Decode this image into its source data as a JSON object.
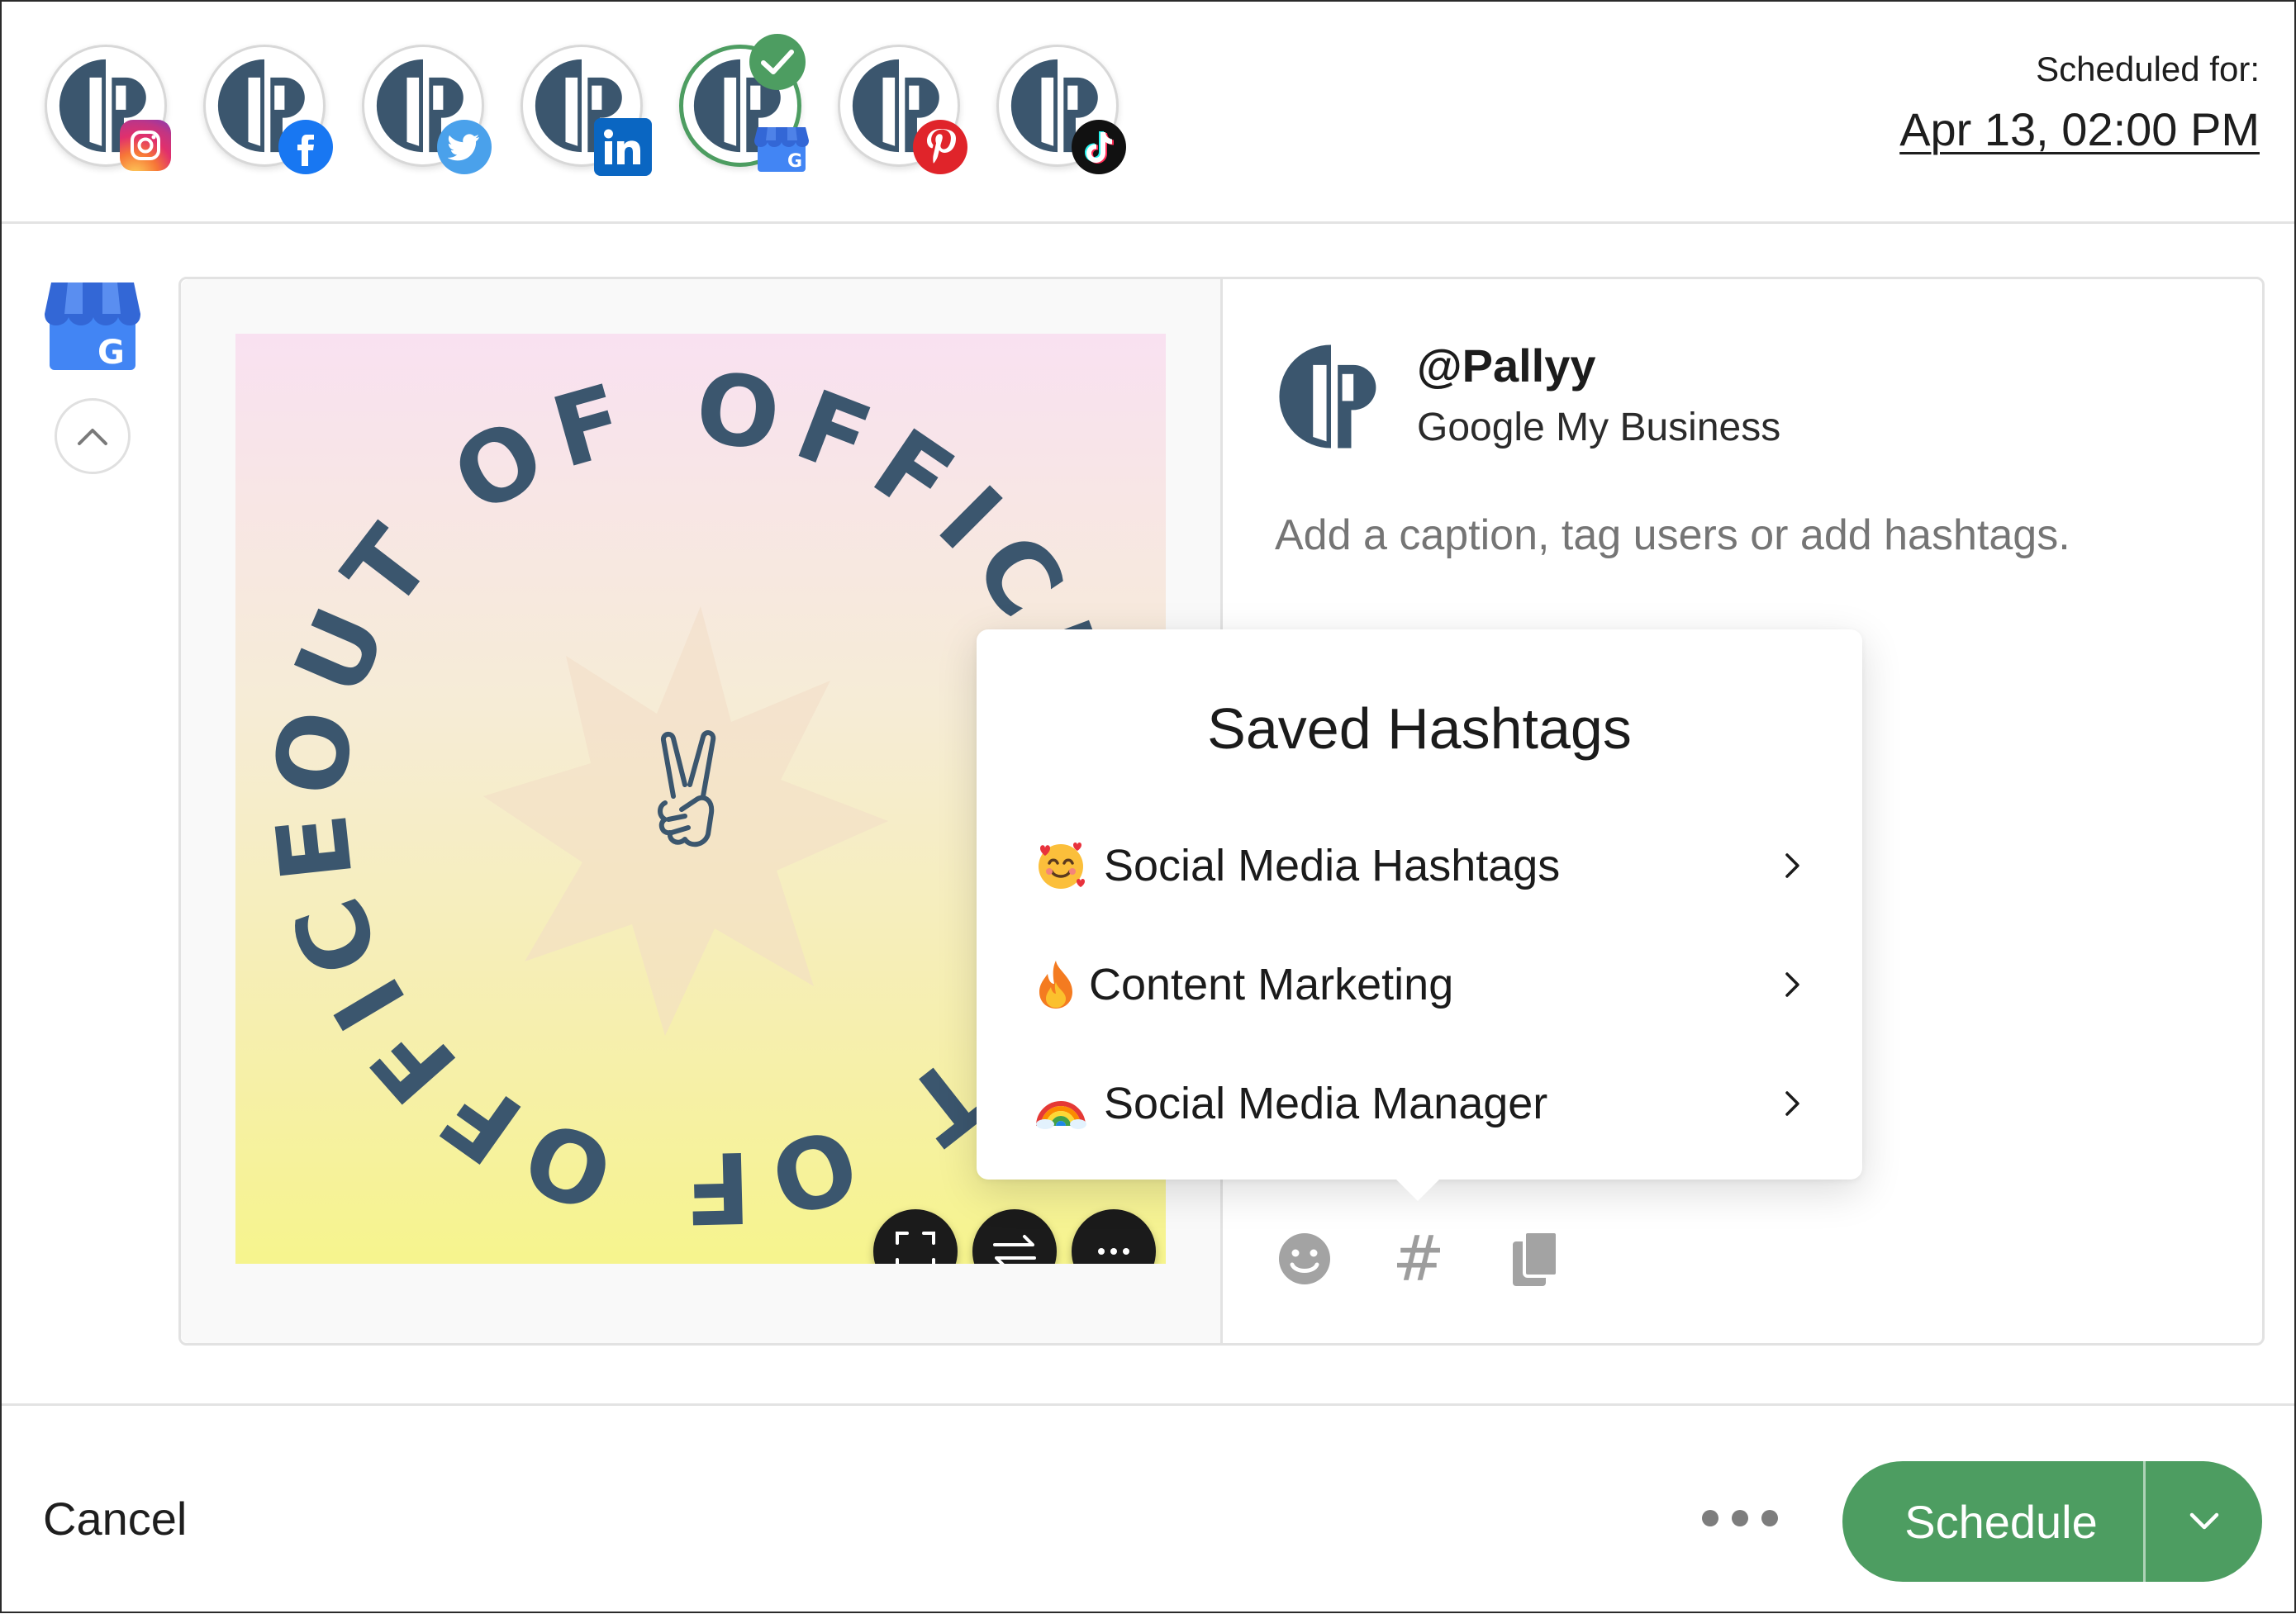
{
  "header": {
    "scheduled_label": "Scheduled for:",
    "scheduled_date": "Apr 13, 02:00 PM",
    "accounts": [
      {
        "network": "instagram",
        "icon": "instagram-icon",
        "selected": false
      },
      {
        "network": "facebook",
        "icon": "facebook-icon",
        "selected": false
      },
      {
        "network": "twitter",
        "icon": "twitter-icon",
        "selected": false
      },
      {
        "network": "linkedin",
        "icon": "linkedin-icon",
        "selected": false
      },
      {
        "network": "google-my-business",
        "icon": "google-my-business-icon",
        "selected": true
      },
      {
        "network": "pinterest",
        "icon": "pinterest-icon",
        "selected": false
      },
      {
        "network": "tiktok",
        "icon": "tiktok-icon",
        "selected": false
      }
    ]
  },
  "colors": {
    "accent_green": "#4d9d61",
    "brand_navy": "#3b566e",
    "placeholder_gray": "#9a9a9a"
  },
  "post": {
    "handle": "@Pallyy",
    "network_name": "Google My Business",
    "caption_placeholder": "Add a caption, tag users or add hashtags.",
    "image_text_top": "OUT OF OFFICE",
    "image_text_bottom": "OUT OF OFFICE",
    "separator": "•"
  },
  "media_actions": [
    {
      "icon": "expand-icon"
    },
    {
      "icon": "swap-icon"
    },
    {
      "icon": "more-icon"
    }
  ],
  "toolbar": {
    "emoji_icon": "emoji-icon",
    "hashtag_symbol": "#",
    "copy_icon": "copy-icon"
  },
  "saved_hashtags": {
    "title": "Saved Hashtags",
    "items": [
      {
        "emoji": "smiling-face-with-hearts",
        "label": "Social Media Hashtags"
      },
      {
        "emoji": "fire",
        "label": "Content Marketing"
      },
      {
        "emoji": "rainbow",
        "label": "Social Media Manager"
      }
    ]
  },
  "footer": {
    "cancel_label": "Cancel",
    "schedule_label": "Schedule"
  }
}
